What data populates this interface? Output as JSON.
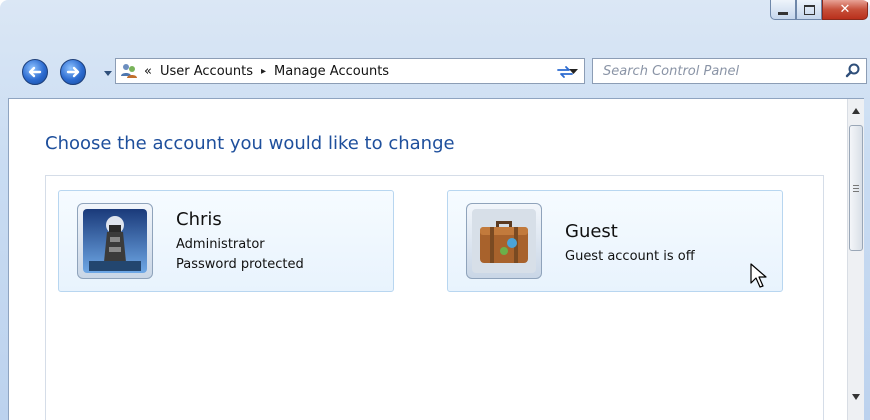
{
  "window": {
    "caption_buttons": {
      "minimize": "minimize-icon",
      "maximize": "maximize-icon",
      "close": "close-icon"
    }
  },
  "nav": {
    "back_icon": "back-arrow-icon",
    "forward_icon": "forward-arrow-icon",
    "breadcrumb_prefix": "«",
    "breadcrumb": [
      "User Accounts",
      "Manage Accounts"
    ],
    "breadcrumb_separator": "▸"
  },
  "search": {
    "placeholder": "Search Control Panel"
  },
  "main": {
    "heading": "Choose the account you would like to change",
    "accounts": [
      {
        "name": "Chris",
        "lines": [
          "Administrator",
          "Password protected"
        ],
        "picture": "lighthouse-picture"
      },
      {
        "name": "Guest",
        "lines": [
          "Guest account is off"
        ],
        "picture": "suitcase-picture"
      }
    ]
  },
  "colors": {
    "heading": "#1e4f9c",
    "tile_border": "#b8d6f0",
    "tile_bg": "#e8f3fd"
  }
}
